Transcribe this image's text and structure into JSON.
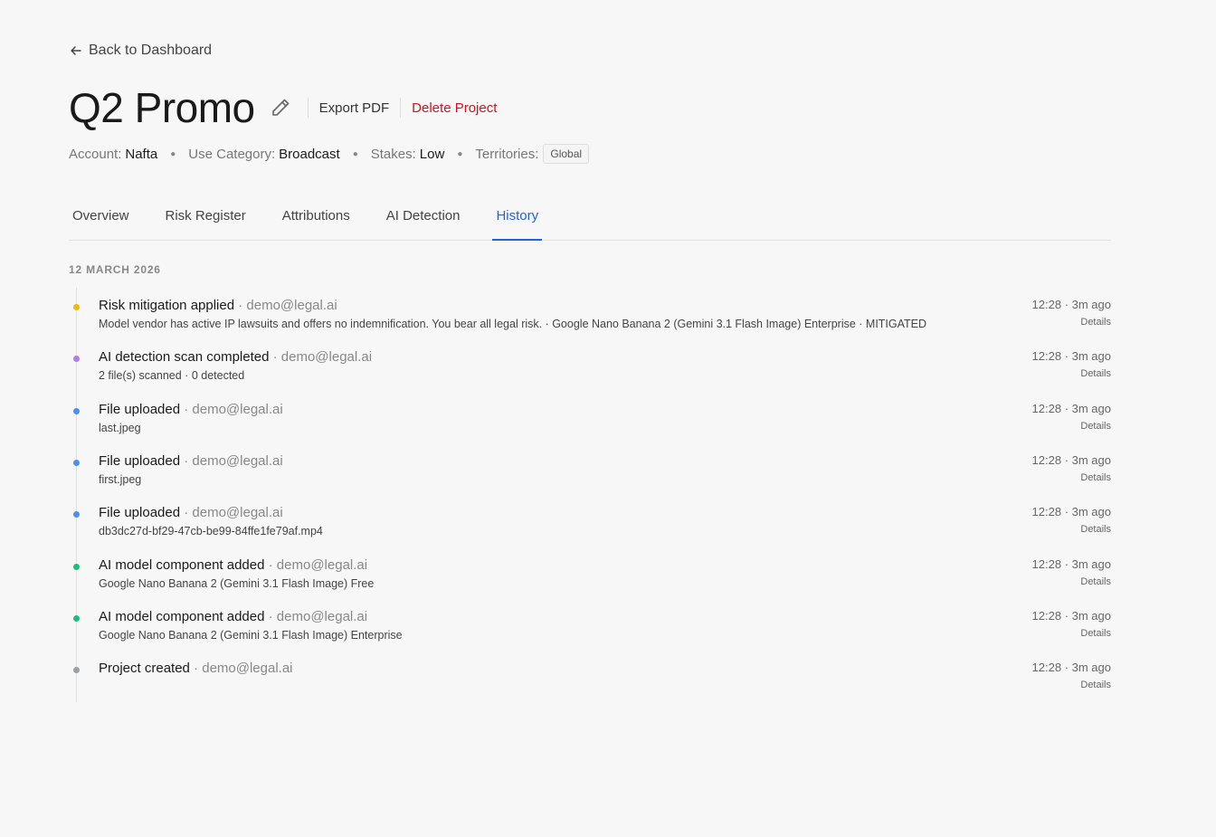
{
  "back_label": "Back to Dashboard",
  "project": {
    "title": "Q2 Promo",
    "export_label": "Export PDF",
    "delete_label": "Delete Project"
  },
  "meta": {
    "account_label": "Account:",
    "account": "Nafta",
    "use_category_label": "Use Category:",
    "use_category": "Broadcast",
    "stakes_label": "Stakes:",
    "stakes": "Low",
    "territories_label": "Territories:",
    "territory": "Global"
  },
  "tabs": [
    "Overview",
    "Risk Register",
    "Attributions",
    "AI Detection",
    "History"
  ],
  "active_tab": "History",
  "history": {
    "date": "12 MARCH 2026",
    "events": [
      {
        "title": "Risk mitigation applied",
        "user": " · demo@legal.ai",
        "sub": "Model vendor has active IP lawsuits and offers no indemnification. You bear all legal risk. · Google Nano Banana 2 (Gemini 3.1 Flash Image) Enterprise · MITIGATED",
        "time": "12:28 · 3m ago",
        "details": "Details",
        "color": "#f5b800"
      },
      {
        "title": "AI detection scan completed",
        "user": " · demo@legal.ai",
        "sub": "2 file(s) scanned · 0 detected",
        "time": "12:28 · 3m ago",
        "details": "Details",
        "color": "#b57af0"
      },
      {
        "title": "File uploaded",
        "user": " · demo@legal.ai",
        "sub": "last.jpeg",
        "time": "12:28 · 3m ago",
        "details": "Details",
        "color": "#4a90f0"
      },
      {
        "title": "File uploaded",
        "user": " · demo@legal.ai",
        "sub": "first.jpeg",
        "time": "12:28 · 3m ago",
        "details": "Details",
        "color": "#4a90f0"
      },
      {
        "title": "File uploaded",
        "user": " · demo@legal.ai",
        "sub": "db3dc27d-bf29-47cb-be99-84ffe1fe79af.mp4",
        "time": "12:28 · 3m ago",
        "details": "Details",
        "color": "#4a90f0"
      },
      {
        "title": "AI model component added",
        "user": " · demo@legal.ai",
        "sub": "Google Nano Banana 2 (Gemini 3.1 Flash Image) Free",
        "time": "12:28 · 3m ago",
        "details": "Details",
        "color": "#18c07a"
      },
      {
        "title": "AI model component added",
        "user": " · demo@legal.ai",
        "sub": "Google Nano Banana 2 (Gemini 3.1 Flash Image) Enterprise",
        "time": "12:28 · 3m ago",
        "details": "Details",
        "color": "#18c07a"
      },
      {
        "title": "Project created",
        "user": " · demo@legal.ai",
        "sub": "",
        "time": "12:28 · 3m ago",
        "details": "Details",
        "color": "#9aa0a8"
      }
    ]
  }
}
